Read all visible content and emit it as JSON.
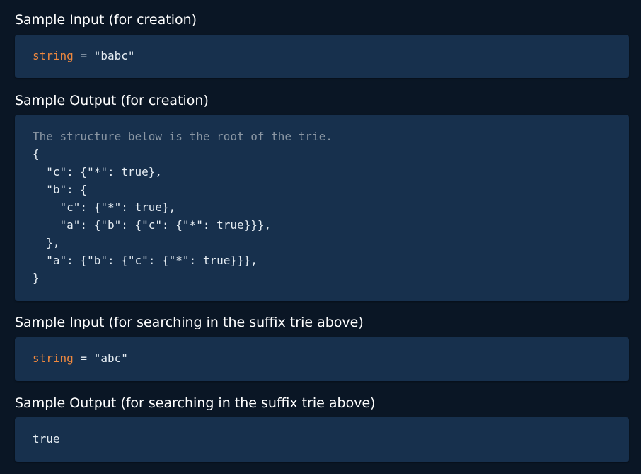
{
  "colors": {
    "page_background": "#0a1625",
    "panel_background": "#17304d",
    "text": "#e6edf3",
    "heading": "#ffffff",
    "keyword": "#f0883e",
    "comment": "#8a96a3"
  },
  "sections": [
    {
      "title": "Sample Input (for creation)",
      "code": {
        "keyword": "string",
        "rest": " = \"babc\""
      }
    },
    {
      "title": "Sample Output (for creation)",
      "comment": "The structure below is the root of the trie.",
      "lines": [
        "{",
        "  \"c\": {\"*\": true},",
        "  \"b\": {",
        "    \"c\": {\"*\": true},",
        "    \"a\": {\"b\": {\"c\": {\"*\": true}}},",
        "  },",
        "  \"a\": {\"b\": {\"c\": {\"*\": true}}},",
        "}"
      ]
    },
    {
      "title": "Sample Input (for searching in the suffix trie above)",
      "code": {
        "keyword": "string",
        "rest": " = \"abc\""
      }
    },
    {
      "title": "Sample Output (for searching in the suffix trie above)",
      "value": "true"
    }
  ]
}
